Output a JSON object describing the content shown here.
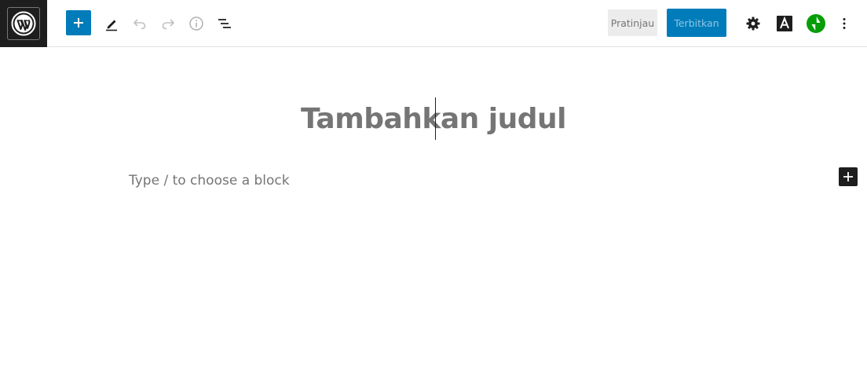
{
  "toolbar": {
    "site_icon": "wordpress-icon",
    "tools": [
      {
        "name": "inserter",
        "icon": "plus-icon",
        "accent": "#007cba"
      },
      {
        "name": "tools",
        "icon": "pencil-icon"
      },
      {
        "name": "undo",
        "icon": "undo-icon"
      },
      {
        "name": "redo",
        "icon": "redo-icon"
      },
      {
        "name": "details",
        "icon": "info-icon"
      },
      {
        "name": "list-view",
        "icon": "list-view-icon"
      }
    ],
    "preview_label": "Pratinjau",
    "publish_label": "Terbitkan",
    "settings_icon": "gear-icon",
    "typography_icon": "typography-a-icon",
    "jetpack_icon": "jetpack-bolt-icon",
    "options_icon": "more-vertical-icon",
    "jetpack_color": "#069e08"
  },
  "editor": {
    "title_placeholder": "Tambahkan judul",
    "block_placeholder": "Type / to choose a block"
  }
}
